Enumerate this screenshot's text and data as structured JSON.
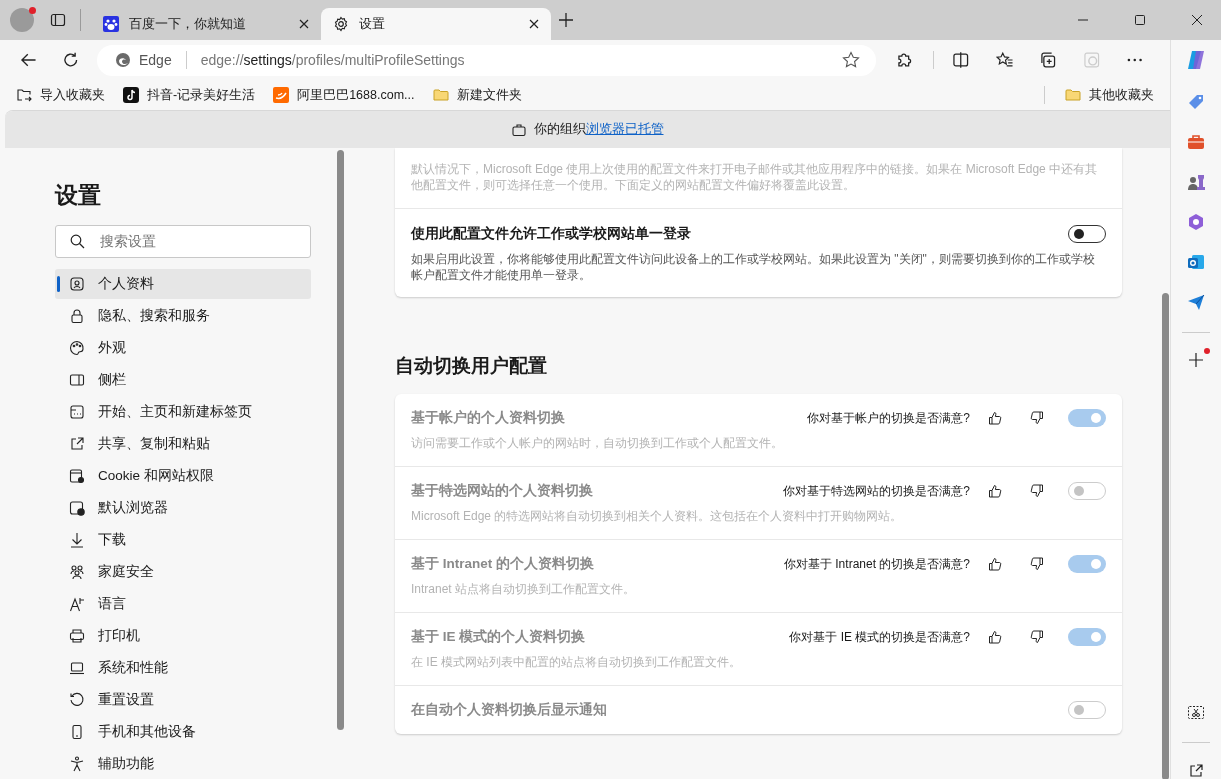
{
  "tabs": [
    {
      "title": "百度一下，你就知道",
      "kind": "baidu",
      "selected": false
    },
    {
      "title": "设置",
      "kind": "settings",
      "selected": true
    }
  ],
  "address_bar": {
    "site_label": "Edge",
    "url_prefix": "edge://",
    "url_host": "settings",
    "url_path": "/profiles/multiProfileSettings"
  },
  "favorites_bar": [
    {
      "label": "导入收藏夹",
      "kind": "import"
    },
    {
      "label": "抖音-记录美好生活",
      "kind": "tiktok"
    },
    {
      "label": "阿里巴巴1688.com...",
      "kind": "alibaba"
    },
    {
      "label": "新建文件夹",
      "kind": "folder"
    }
  ],
  "other_favorites": "其他收藏夹",
  "banner": {
    "text": "你的组织",
    "link": "浏览器已托管"
  },
  "sidebar": {
    "title": "设置",
    "search_placeholder": "搜索设置",
    "items": [
      {
        "label": "个人资料",
        "selected": true
      },
      {
        "label": "隐私、搜索和服务",
        "selected": false
      },
      {
        "label": "外观",
        "selected": false
      },
      {
        "label": "侧栏",
        "selected": false
      },
      {
        "label": "开始、主页和新建标签页",
        "selected": false
      },
      {
        "label": "共享、复制和粘贴",
        "selected": false
      },
      {
        "label": "Cookie 和网站权限",
        "selected": false
      },
      {
        "label": "默认浏览器",
        "selected": false
      },
      {
        "label": "下载",
        "selected": false
      },
      {
        "label": "家庭安全",
        "selected": false
      },
      {
        "label": "语言",
        "selected": false
      },
      {
        "label": "打印机",
        "selected": false
      },
      {
        "label": "系统和性能",
        "selected": false
      },
      {
        "label": "重置设置",
        "selected": false
      },
      {
        "label": "手机和其他设备",
        "selected": false
      },
      {
        "label": "辅助功能",
        "selected": false
      }
    ]
  },
  "profile_card": {
    "description": "默认情况下，Microsoft Edge 使用上次使用的配置文件来打开电子邮件或其他应用程序中的链接。如果在 Microsoft Edge 中还有其他配置文件，则可选择任意一个使用。下面定义的网站配置文件偏好将覆盖此设置。",
    "rows": [
      {
        "title": "使用此配置文件允许工作或学校网站单一登录",
        "description": "如果启用此设置，你将能够使用此配置文件访问此设备上的工作或学校网站。如果此设置为 \"关闭\"，则需要切换到你的工作或学校帐户配置文件才能使用单一登录。",
        "on": false,
        "disabled": false
      }
    ]
  },
  "auto_switch": {
    "heading": "自动切换用户配置",
    "rows": [
      {
        "title": "基于帐户的个人资料切换",
        "feedback_question": "你对基于帐户的切换是否满意?",
        "description": "访问需要工作或个人帐户的网站时，自动切换到工作或个人配置文件。",
        "on": true,
        "disabled": true
      },
      {
        "title": "基于特选网站的个人资料切换",
        "feedback_question": "你对基于特选网站的切换是否满意?",
        "description": "Microsoft Edge 的特选网站将自动切换到相关个人资料。这包括在个人资料中打开购物网站。",
        "on": false,
        "disabled": true
      },
      {
        "title": "基于 Intranet 的个人资料切换",
        "feedback_question": "你对基于 Intranet 的切换是否满意?",
        "description": "Intranet 站点将自动切换到工作配置文件。",
        "on": true,
        "disabled": true
      },
      {
        "title": "基于 IE 模式的个人资料切换",
        "feedback_question": "你对基于 IE 模式的切换是否满意?",
        "description": "在 IE 模式网站列表中配置的站点将自动切换到工作配置文件。",
        "on": true,
        "disabled": true
      },
      {
        "title": "在自动个人资料切换后显示通知",
        "on": false,
        "disabled": true
      }
    ]
  }
}
